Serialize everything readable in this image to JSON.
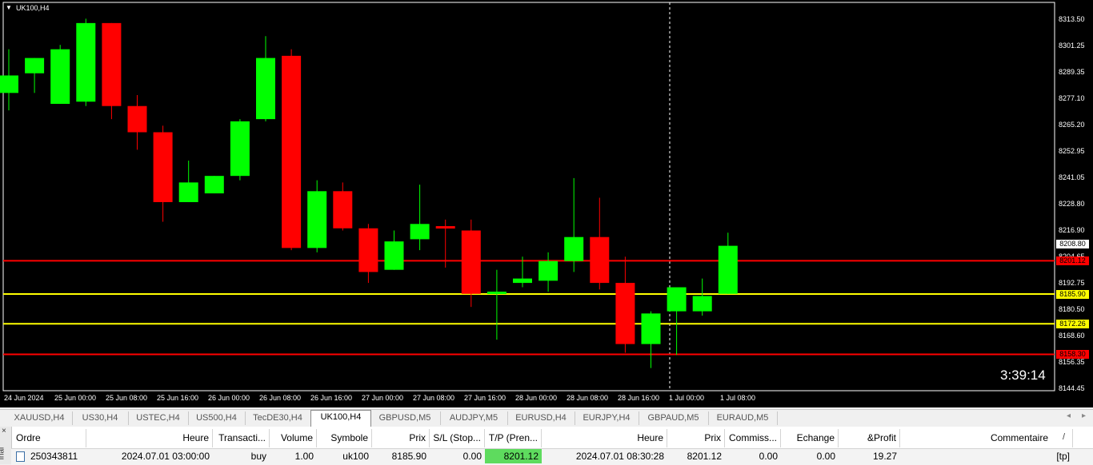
{
  "chart": {
    "title": "UK100,H4",
    "countdown": "3:39:14",
    "colors": {
      "background": "#000000",
      "bull": "#00ff00",
      "bear": "#ff0000",
      "support_line": "#ffff00",
      "resistance_line": "#ff0000",
      "text": "#ffffff"
    },
    "price_ticks": [
      "8313.50",
      "8301.25",
      "8289.35",
      "8277.10",
      "8265.20",
      "8252.95",
      "8241.05",
      "8228.80",
      "8216.90",
      "8204.65",
      "8192.75",
      "8180.50",
      "8168.60",
      "8156.35",
      "8144.45"
    ],
    "time_ticks": [
      "24 Jun 2024",
      "25 Jun 00:00",
      "25 Jun 08:00",
      "25 Jun 16:00",
      "26 Jun 00:00",
      "26 Jun 08:00",
      "26 Jun 16:00",
      "27 Jun 00:00",
      "27 Jun 08:00",
      "27 Jun 16:00",
      "28 Jun 00:00",
      "28 Jun 08:00",
      "28 Jun 16:00",
      "1 Jul 00:00",
      "1 Jul 08:00"
    ],
    "price_tags": [
      {
        "label": "8208.80",
        "bg": "#ffffff",
        "fg": "#000000",
        "price": 8208.8
      },
      {
        "label": "8201.12",
        "bg": "#ff0000",
        "fg": "#000000",
        "price": 8201.12
      },
      {
        "label": "8185.90",
        "bg": "#ffff00",
        "fg": "#000000",
        "price": 8185.9
      },
      {
        "label": "8172.26",
        "bg": "#ffff00",
        "fg": "#000000",
        "price": 8172.26
      },
      {
        "label": "8158.30",
        "bg": "#ff0000",
        "fg": "#000000",
        "price": 8158.3
      }
    ]
  },
  "chart_data": {
    "type": "candlestick",
    "title": "UK100,H4",
    "ylim": [
      8142,
      8318
    ],
    "horizontal_levels": [
      {
        "price": 8201.12,
        "color": "#ff0000"
      },
      {
        "price": 8185.9,
        "color": "#ffff00"
      },
      {
        "price": 8172.26,
        "color": "#ffff00"
      },
      {
        "price": 8158.3,
        "color": "#ff0000"
      }
    ],
    "candles": [
      {
        "o": 8278,
        "h": 8298,
        "l": 8270,
        "c": 8286
      },
      {
        "o": 8287,
        "h": 8294,
        "l": 8278,
        "c": 8294
      },
      {
        "o": 8273,
        "h": 8300,
        "l": 8273,
        "c": 8298
      },
      {
        "o": 8274,
        "h": 8312,
        "l": 8272,
        "c": 8310
      },
      {
        "o": 8310,
        "h": 8310,
        "l": 8266,
        "c": 8272
      },
      {
        "o": 8272,
        "h": 8277,
        "l": 8252,
        "c": 8260
      },
      {
        "o": 8260,
        "h": 8263,
        "l": 8219,
        "c": 8228
      },
      {
        "o": 8228,
        "h": 8247,
        "l": 8228,
        "c": 8237
      },
      {
        "o": 8232,
        "h": 8240,
        "l": 8232,
        "c": 8240
      },
      {
        "o": 8240,
        "h": 8266,
        "l": 8238,
        "c": 8265
      },
      {
        "o": 8266,
        "h": 8304,
        "l": 8265,
        "c": 8294
      },
      {
        "o": 8295,
        "h": 8298,
        "l": 8206,
        "c": 8207
      },
      {
        "o": 8207,
        "h": 8238,
        "l": 8205,
        "c": 8233
      },
      {
        "o": 8233,
        "h": 8237,
        "l": 8215,
        "c": 8216
      },
      {
        "o": 8216,
        "h": 8218,
        "l": 8191,
        "c": 8196
      },
      {
        "o": 8197,
        "h": 8215,
        "l": 8197,
        "c": 8210
      },
      {
        "o": 8211,
        "h": 8236,
        "l": 8206,
        "c": 8218
      },
      {
        "o": 8217,
        "h": 8220,
        "l": 8198,
        "c": 8216
      },
      {
        "o": 8215,
        "h": 8220,
        "l": 8180,
        "c": 8186
      },
      {
        "o": 8186,
        "h": 8197,
        "l": 8165,
        "c": 8187
      },
      {
        "o": 8191,
        "h": 8203,
        "l": 8189,
        "c": 8193
      },
      {
        "o": 8192,
        "h": 8205,
        "l": 8187,
        "c": 8201
      },
      {
        "o": 8201,
        "h": 8239,
        "l": 8196,
        "c": 8212
      },
      {
        "o": 8212,
        "h": 8230,
        "l": 8188,
        "c": 8191
      },
      {
        "o": 8191,
        "h": 8203,
        "l": 8159,
        "c": 8163
      },
      {
        "o": 8163,
        "h": 8178,
        "l": 8152,
        "c": 8177
      },
      {
        "o": 8178,
        "h": 8188,
        "l": 8158,
        "c": 8189
      },
      {
        "o": 8178,
        "h": 8193,
        "l": 8176,
        "c": 8185
      },
      {
        "o": 8186,
        "h": 8214,
        "l": 8186,
        "c": 8208
      }
    ]
  },
  "tabs": [
    "XAUUSD,H4",
    "US30,H4",
    "USTEC,H4",
    "US500,H4",
    "TecDE30,H4",
    "UK100,H4",
    "GBPUSD,M5",
    "AUDJPY,M5",
    "EURUSD,H4",
    "EURJPY,H4",
    "GBPAUD,M5",
    "EURAUD,M5"
  ],
  "active_tab": "UK100,H4",
  "tab_nav": {
    "prev": "◂",
    "next": "▸"
  },
  "terminal": {
    "side_close": "×",
    "side_label": "inal",
    "columns": [
      "Ordre",
      "Heure",
      "Transacti...",
      "Volume",
      "Symbole",
      "Prix",
      "S/L (Stop...",
      "T/P (Pren...",
      "Heure",
      "Prix",
      "Commiss...",
      "Echange",
      "&Profit",
      "Commentaire"
    ],
    "sort_marker": "/",
    "row": {
      "ordre": "250343811",
      "heure_open": "2024.07.01 03:00:00",
      "type": "buy",
      "volume": "1.00",
      "symbole": "uk100",
      "prix_open": "8185.90",
      "sl": "0.00",
      "tp": "8201.12",
      "heure_close": "2024.07.01 08:30:28",
      "prix_close": "8201.12",
      "commission": "0.00",
      "echange": "0.00",
      "profit": "19.27",
      "commentaire": "[tp]"
    },
    "tp_highlight": "#5edb5e"
  }
}
